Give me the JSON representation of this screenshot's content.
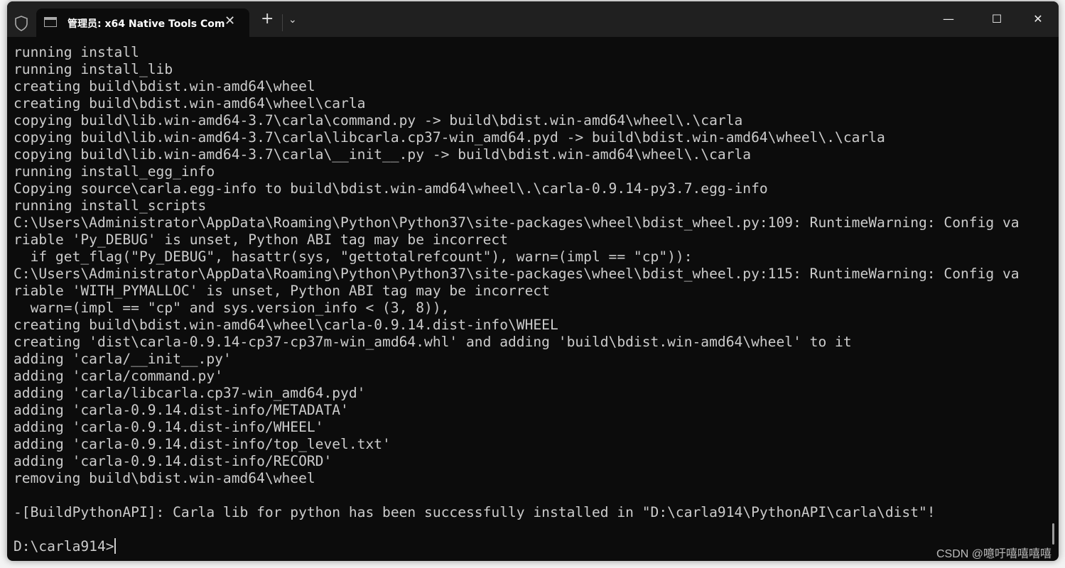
{
  "window": {
    "tab_title": "管理员: x64 Native Tools Com",
    "controls": {
      "minimize": "—",
      "maximize": "☐",
      "close": "✕"
    },
    "new_tab": "+",
    "dropdown": "⌄",
    "tab_close": "✕"
  },
  "terminal": {
    "lines": [
      "running install",
      "running install_lib",
      "creating build\\bdist.win-amd64\\wheel",
      "creating build\\bdist.win-amd64\\wheel\\carla",
      "copying build\\lib.win-amd64-3.7\\carla\\command.py -> build\\bdist.win-amd64\\wheel\\.\\carla",
      "copying build\\lib.win-amd64-3.7\\carla\\libcarla.cp37-win_amd64.pyd -> build\\bdist.win-amd64\\wheel\\.\\carla",
      "copying build\\lib.win-amd64-3.7\\carla\\__init__.py -> build\\bdist.win-amd64\\wheel\\.\\carla",
      "running install_egg_info",
      "Copying source\\carla.egg-info to build\\bdist.win-amd64\\wheel\\.\\carla-0.9.14-py3.7.egg-info",
      "running install_scripts",
      "C:\\Users\\Administrator\\AppData\\Roaming\\Python\\Python37\\site-packages\\wheel\\bdist_wheel.py:109: RuntimeWarning: Config va",
      "riable 'Py_DEBUG' is unset, Python ABI tag may be incorrect",
      "  if get_flag(\"Py_DEBUG\", hasattr(sys, \"gettotalrefcount\"), warn=(impl == \"cp\")):",
      "C:\\Users\\Administrator\\AppData\\Roaming\\Python\\Python37\\site-packages\\wheel\\bdist_wheel.py:115: RuntimeWarning: Config va",
      "riable 'WITH_PYMALLOC' is unset, Python ABI tag may be incorrect",
      "  warn=(impl == \"cp\" and sys.version_info < (3, 8)),",
      "creating build\\bdist.win-amd64\\wheel\\carla-0.9.14.dist-info\\WHEEL",
      "creating 'dist\\carla-0.9.14-cp37-cp37m-win_amd64.whl' and adding 'build\\bdist.win-amd64\\wheel' to it",
      "adding 'carla/__init__.py'",
      "adding 'carla/command.py'",
      "adding 'carla/libcarla.cp37-win_amd64.pyd'",
      "adding 'carla-0.9.14.dist-info/METADATA'",
      "adding 'carla-0.9.14.dist-info/WHEEL'",
      "adding 'carla-0.9.14.dist-info/top_level.txt'",
      "adding 'carla-0.9.14.dist-info/RECORD'",
      "removing build\\bdist.win-amd64\\wheel",
      "",
      "-[BuildPythonAPI]: Carla lib for python has been successfully installed in \"D:\\carla914\\PythonAPI\\carla\\dist\"!",
      "",
      "D:\\carla914>"
    ]
  },
  "watermark": "CSDN @噫吁嘻嘻嘻嘻"
}
